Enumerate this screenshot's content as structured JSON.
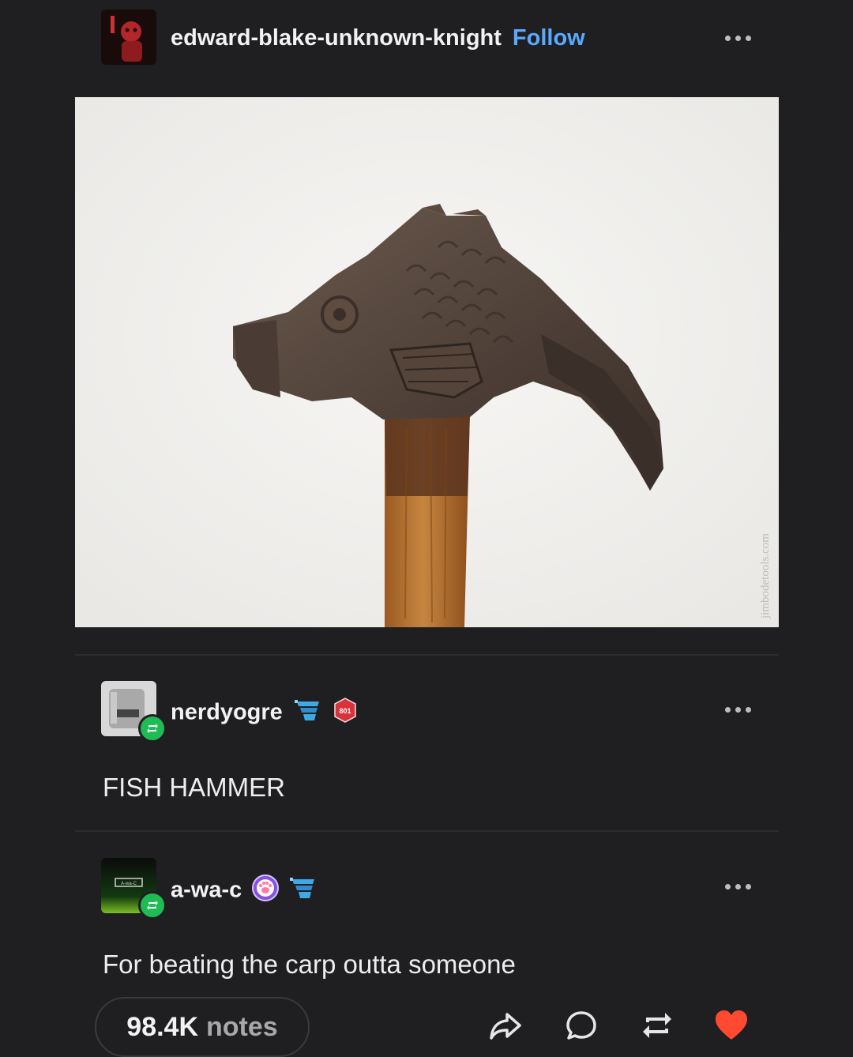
{
  "post": {
    "author": "edward-blake-unknown-knight",
    "follow_label": "Follow",
    "image_watermark": "jimbodetools.com"
  },
  "reblogs": [
    {
      "username": "nerdyogre",
      "text": "FISH HAMMER",
      "badge_text": "801"
    },
    {
      "username": "a-wa-c",
      "text": "For beating the carp outta someone",
      "avatar_text": "A-wa-C"
    }
  ],
  "footer": {
    "notes_count": "98.4K",
    "notes_label": "notes"
  },
  "icons": [
    "more-icon",
    "reblog-icon",
    "share-icon",
    "reply-icon",
    "heart-icon"
  ],
  "colors": {
    "background": "#1f1f21",
    "follow": "#5aa9ff",
    "heart": "#ff4930",
    "reblog_badge": "#1fbb55"
  }
}
